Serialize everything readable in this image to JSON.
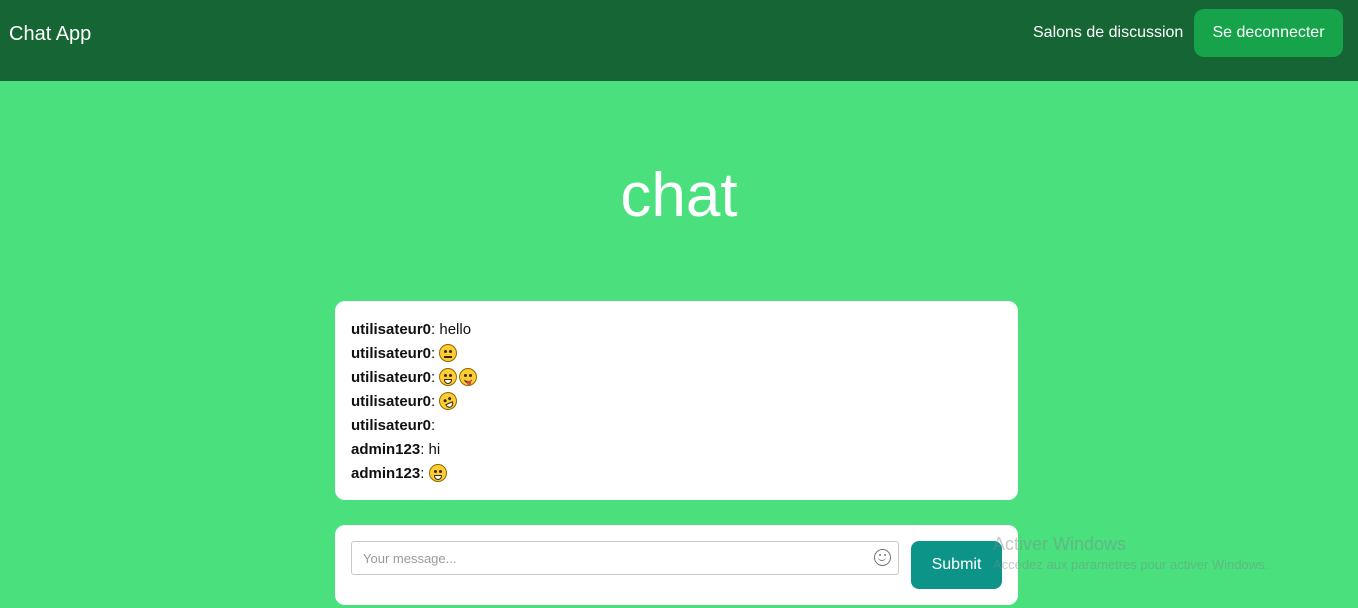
{
  "navbar": {
    "brand": "Chat App",
    "rooms_link": "Salons de discussion",
    "logout_label": "Se deconnecter"
  },
  "page": {
    "title": "chat"
  },
  "messages": [
    {
      "user": "utilisateur0",
      "sep": ": ",
      "text": "hello",
      "emojis": []
    },
    {
      "user": "utilisateur0",
      "sep": ": ",
      "text": "",
      "emojis": [
        "unamused-face-icon"
      ]
    },
    {
      "user": "utilisateur0",
      "sep": ": ",
      "text": "",
      "emojis": [
        "grinning-face-icon",
        "winking-tongue-face-icon"
      ]
    },
    {
      "user": "utilisateur0",
      "sep": ": ",
      "text": "",
      "emojis": [
        "rofl-face-icon"
      ]
    },
    {
      "user": "utilisateur0",
      "sep": ":",
      "text": "",
      "emojis": []
    },
    {
      "user": "admin123",
      "sep": ": ",
      "text": "hi",
      "emojis": []
    },
    {
      "user": "admin123",
      "sep": ": ",
      "text": "",
      "emojis": [
        "grimacing-face-icon"
      ]
    }
  ],
  "composer": {
    "value": "",
    "placeholder": "Your message...",
    "emoji_icon": "smiley-icon",
    "submit_label": "Submit"
  },
  "watermark": {
    "title": "Activer Windows",
    "subtitle": "Accédez aux paramètres pour activer Windows."
  },
  "colors": {
    "navbar_bg": "#166534",
    "page_bg": "#4ae07e",
    "logout_bg": "#16a34a",
    "submit_bg": "#0d9488"
  }
}
